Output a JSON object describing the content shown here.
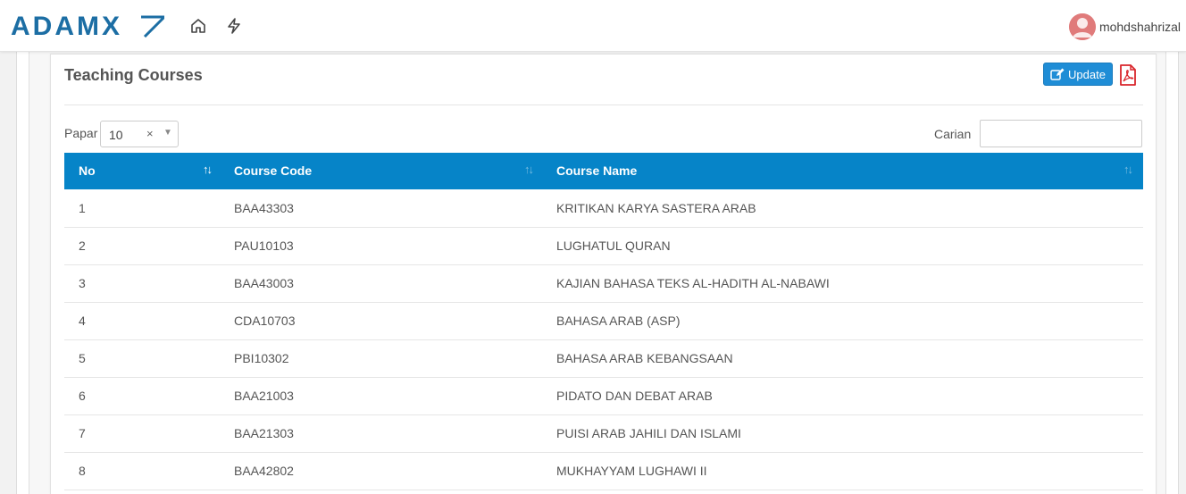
{
  "header": {
    "logo_text": "ADAMX",
    "home_icon": "home-icon",
    "bolt_icon": "bolt-icon",
    "user_name": "mohdshahrizal",
    "avatar_icon": "user-avatar-icon"
  },
  "card": {
    "title": "Teaching Courses",
    "update_label": "Update",
    "update_icon": "edit-icon",
    "pdf_icon": "pdf-icon"
  },
  "controls": {
    "papar_label": "Papar",
    "papar_value": "10",
    "carian_label": "Carian",
    "carian_value": ""
  },
  "table": {
    "columns": [
      "No",
      "Course Code",
      "Course Name"
    ],
    "rows": [
      {
        "no": "1",
        "code": "BAA43303",
        "name": "KRITIKAN KARYA SASTERA ARAB"
      },
      {
        "no": "2",
        "code": "PAU10103",
        "name": "LUGHATUL QURAN"
      },
      {
        "no": "3",
        "code": "BAA43003",
        "name": "KAJIAN BAHASA TEKS AL-HADITH AL-NABAWI"
      },
      {
        "no": "4",
        "code": "CDA10703",
        "name": "BAHASA ARAB (ASP)"
      },
      {
        "no": "5",
        "code": "PBI10302",
        "name": "BAHASA ARAB KEBANGSAAN"
      },
      {
        "no": "6",
        "code": "BAA21003",
        "name": "PIDATO DAN DEBAT ARAB"
      },
      {
        "no": "7",
        "code": "BAA21303",
        "name": "PUISI ARAB JAHILI DAN ISLAMI"
      },
      {
        "no": "8",
        "code": "BAA42802",
        "name": "MUKHAYYAM LUGHAWI II"
      }
    ]
  },
  "colors": {
    "table_header": "#0684c8",
    "update_button": "#1f8dd6",
    "pdf_red": "#d9262c",
    "logo_blue": "#1c6ea4"
  }
}
